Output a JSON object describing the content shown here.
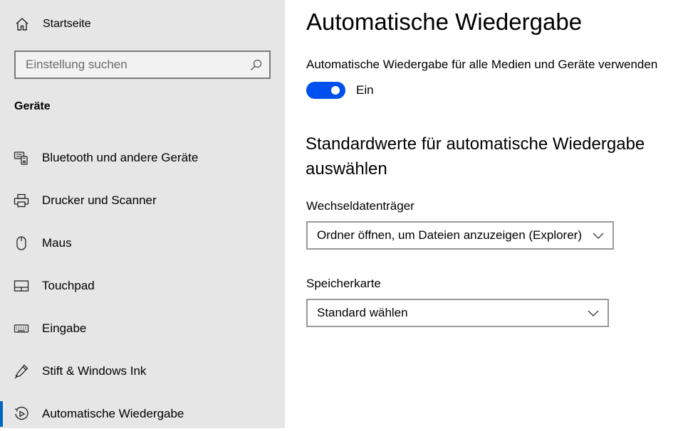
{
  "sidebar": {
    "home_label": "Startseite",
    "search": {
      "placeholder": "Einstellung suchen",
      "value": ""
    },
    "section_title": "Geräte",
    "items": [
      {
        "label": "Bluetooth und andere Geräte",
        "icon": "bluetooth-devices-icon"
      },
      {
        "label": "Drucker und Scanner",
        "icon": "printer-icon"
      },
      {
        "label": "Maus",
        "icon": "mouse-icon"
      },
      {
        "label": "Touchpad",
        "icon": "touchpad-icon"
      },
      {
        "label": "Eingabe",
        "icon": "keyboard-icon"
      },
      {
        "label": "Stift & Windows Ink",
        "icon": "pen-icon"
      },
      {
        "label": "Automatische Wiedergabe",
        "icon": "autoplay-icon",
        "active": true
      }
    ]
  },
  "main": {
    "title": "Automatische Wiedergabe",
    "toggle": {
      "label": "Automatische Wiedergabe für alle Medien und Geräte verwenden",
      "state_label": "Ein",
      "on": true
    },
    "defaults_title": "Standardwerte für automatische Wiedergabe auswählen",
    "fields": [
      {
        "label": "Wechseldatenträger",
        "value": "Ordner öffnen, um Dateien anzuzeigen (Explorer)"
      },
      {
        "label": "Speicherkarte",
        "value": "Standard wählen"
      }
    ]
  },
  "colors": {
    "accent": "#0050ef",
    "sidebar_bg": "#e6e6e6",
    "active_indicator": "#0067c0"
  }
}
